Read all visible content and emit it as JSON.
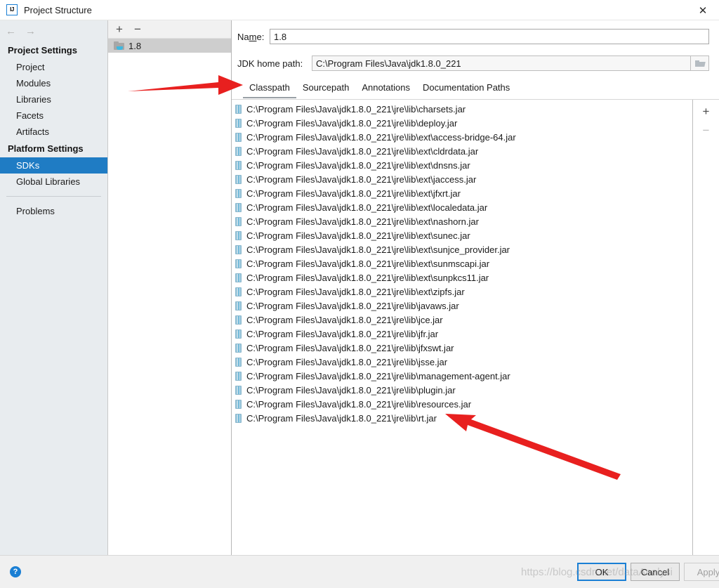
{
  "window": {
    "title": "Project Structure",
    "app_icon": "IJ",
    "close_icon": "✕"
  },
  "sidebar": {
    "nav": {
      "back_icon": "←",
      "forward_icon": "→"
    },
    "groups": [
      {
        "title": "Project Settings",
        "items": [
          {
            "label": "Project",
            "selected": false
          },
          {
            "label": "Modules",
            "selected": false
          },
          {
            "label": "Libraries",
            "selected": false
          },
          {
            "label": "Facets",
            "selected": false
          },
          {
            "label": "Artifacts",
            "selected": false
          }
        ]
      },
      {
        "title": "Platform Settings",
        "items": [
          {
            "label": "SDKs",
            "selected": true
          },
          {
            "label": "Global Libraries",
            "selected": false
          }
        ]
      }
    ],
    "problems_label": "Problems"
  },
  "sdk_panel": {
    "toolbar": {
      "add_label": "+",
      "remove_label": "−"
    },
    "items": [
      {
        "label": "1.8",
        "selected": true,
        "icon": "folder-java-icon"
      }
    ]
  },
  "detail": {
    "name_label": "Name:",
    "name_value": "1.8",
    "jdk_home_label": "JDK home path:",
    "jdk_home_value": "C:\\Program Files\\Java\\jdk1.8.0_221",
    "browse_icon": "folder-open-icon",
    "tabs": [
      {
        "label": "Classpath",
        "active": true
      },
      {
        "label": "Sourcepath",
        "active": false
      },
      {
        "label": "Annotations",
        "active": false
      },
      {
        "label": "Documentation Paths",
        "active": false
      }
    ],
    "side_toolbar": {
      "add_label": "+",
      "remove_label": "−",
      "remove_disabled": true
    },
    "classpath": [
      "C:\\Program Files\\Java\\jdk1.8.0_221\\jre\\lib\\charsets.jar",
      "C:\\Program Files\\Java\\jdk1.8.0_221\\jre\\lib\\deploy.jar",
      "C:\\Program Files\\Java\\jdk1.8.0_221\\jre\\lib\\ext\\access-bridge-64.jar",
      "C:\\Program Files\\Java\\jdk1.8.0_221\\jre\\lib\\ext\\cldrdata.jar",
      "C:\\Program Files\\Java\\jdk1.8.0_221\\jre\\lib\\ext\\dnsns.jar",
      "C:\\Program Files\\Java\\jdk1.8.0_221\\jre\\lib\\ext\\jaccess.jar",
      "C:\\Program Files\\Java\\jdk1.8.0_221\\jre\\lib\\ext\\jfxrt.jar",
      "C:\\Program Files\\Java\\jdk1.8.0_221\\jre\\lib\\ext\\localedata.jar",
      "C:\\Program Files\\Java\\jdk1.8.0_221\\jre\\lib\\ext\\nashorn.jar",
      "C:\\Program Files\\Java\\jdk1.8.0_221\\jre\\lib\\ext\\sunec.jar",
      "C:\\Program Files\\Java\\jdk1.8.0_221\\jre\\lib\\ext\\sunjce_provider.jar",
      "C:\\Program Files\\Java\\jdk1.8.0_221\\jre\\lib\\ext\\sunmscapi.jar",
      "C:\\Program Files\\Java\\jdk1.8.0_221\\jre\\lib\\ext\\sunpkcs11.jar",
      "C:\\Program Files\\Java\\jdk1.8.0_221\\jre\\lib\\ext\\zipfs.jar",
      "C:\\Program Files\\Java\\jdk1.8.0_221\\jre\\lib\\javaws.jar",
      "C:\\Program Files\\Java\\jdk1.8.0_221\\jre\\lib\\jce.jar",
      "C:\\Program Files\\Java\\jdk1.8.0_221\\jre\\lib\\jfr.jar",
      "C:\\Program Files\\Java\\jdk1.8.0_221\\jre\\lib\\jfxswt.jar",
      "C:\\Program Files\\Java\\jdk1.8.0_221\\jre\\lib\\jsse.jar",
      "C:\\Program Files\\Java\\jdk1.8.0_221\\jre\\lib\\management-agent.jar",
      "C:\\Program Files\\Java\\jdk1.8.0_221\\jre\\lib\\plugin.jar",
      "C:\\Program Files\\Java\\jdk1.8.0_221\\jre\\lib\\resources.jar",
      "C:\\Program Files\\Java\\jdk1.8.0_221\\jre\\lib\\rt.jar"
    ]
  },
  "footer": {
    "help_label": "?",
    "ok_label": "OK",
    "cancel_label": "Cancel",
    "apply_label": "Apply"
  },
  "watermark": {
    "text": "https://blog.csdn.net/dataAnalysi"
  },
  "colors": {
    "accent": "#1f7cc4",
    "sidebar_bg": "#e8ecef",
    "annotation_red": "#e8201f",
    "selection_gray": "#cecece"
  }
}
